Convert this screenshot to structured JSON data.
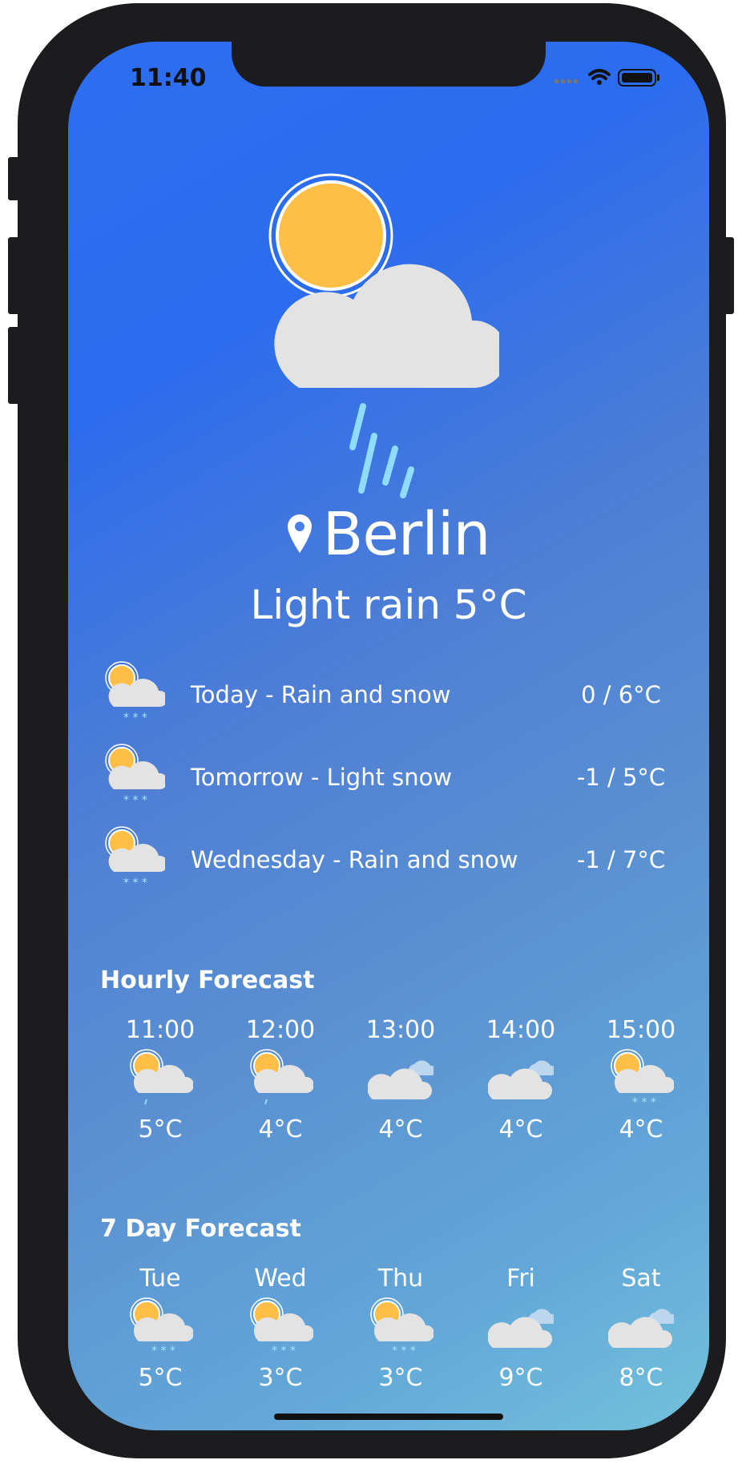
{
  "status": {
    "time": "11:40"
  },
  "current": {
    "city": "Berlin",
    "condition": "Light rain 5°C",
    "icon": "sun-cloud-rain-icon"
  },
  "daily": [
    {
      "label": "Today - Rain and snow",
      "range": "0 / 6°C",
      "icon": "sun-cloud-snow-icon"
    },
    {
      "label": "Tomorrow - Light snow",
      "range": "-1 / 5°C",
      "icon": "sun-cloud-snow-icon"
    },
    {
      "label": "Wednesday - Rain and snow",
      "range": "-1 / 7°C",
      "icon": "sun-cloud-snow-icon"
    }
  ],
  "hourly": {
    "title": "Hourly Forecast",
    "items": [
      {
        "label": "11:00",
        "temp": "5°C",
        "icon": "sun-cloud-drizzle-icon"
      },
      {
        "label": "12:00",
        "temp": "4°C",
        "icon": "sun-cloud-drizzle-icon"
      },
      {
        "label": "13:00",
        "temp": "4°C",
        "icon": "cloudy-icon"
      },
      {
        "label": "14:00",
        "temp": "4°C",
        "icon": "cloudy-icon"
      },
      {
        "label": "15:00",
        "temp": "4°C",
        "icon": "sun-cloud-snow-icon"
      }
    ]
  },
  "weekly": {
    "title": "7 Day Forecast",
    "items": [
      {
        "label": "Tue",
        "temp": "5°C",
        "icon": "sun-cloud-snow-icon"
      },
      {
        "label": "Wed",
        "temp": "3°C",
        "icon": "sun-cloud-snow-icon"
      },
      {
        "label": "Thu",
        "temp": "3°C",
        "icon": "sun-cloud-snow-icon"
      },
      {
        "label": "Fri",
        "temp": "9°C",
        "icon": "cloudy-icon"
      },
      {
        "label": "Sat",
        "temp": "8°C",
        "icon": "cloudy-icon"
      }
    ]
  },
  "colors": {
    "sun": "#ffbf47",
    "cloud": "#e3e3e3",
    "rain": "#8fdcff",
    "snow": "#a8e4ff"
  }
}
